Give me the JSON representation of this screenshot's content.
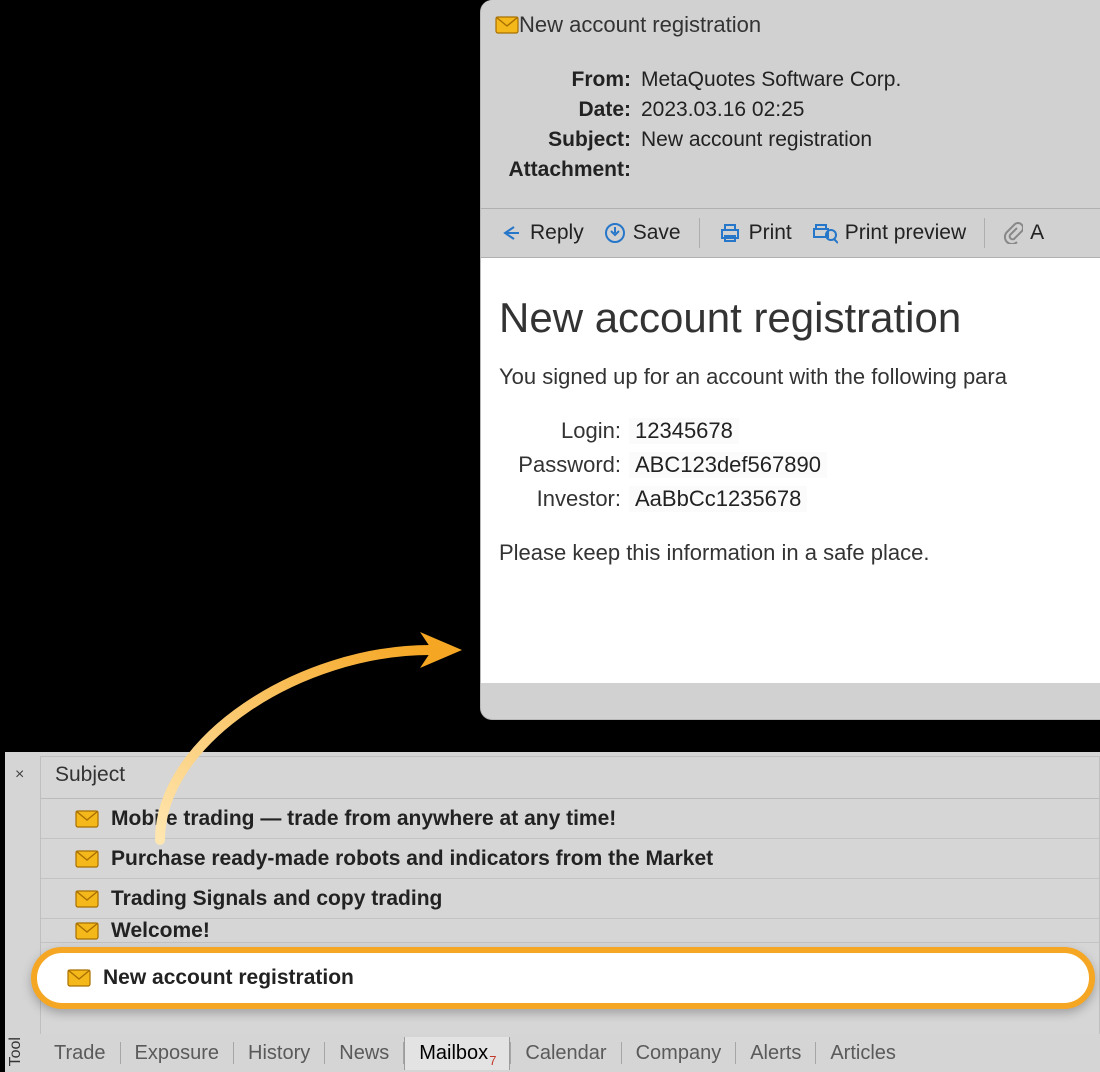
{
  "message": {
    "title": "New account registration",
    "headers": {
      "from_label": "From:",
      "from_value": "MetaQuotes Software Corp.",
      "date_label": "Date:",
      "date_value": "2023.03.16 02:25",
      "subject_label": "Subject:",
      "subject_value": "New account registration",
      "attachment_label": "Attachment:"
    },
    "toolbar": {
      "reply": "Reply",
      "save": "Save",
      "print": "Print",
      "print_preview": "Print preview",
      "attach_fragment": "A"
    },
    "body": {
      "heading": "New account registration",
      "intro": "You signed up for an account with the following para",
      "credentials": {
        "login_label": "Login:",
        "login_value": "12345678",
        "password_label": "Password:",
        "password_value": "ABC123def567890",
        "investor_label": "Investor:",
        "investor_value": "AaBbCc1235678"
      },
      "safe_note": "Please keep this information in a safe place."
    }
  },
  "toolbox": {
    "close_glyph": "×",
    "vertical_label": "Tool",
    "list_header": "Subject",
    "items": [
      "Mobile trading — trade from anywhere at any time!",
      "Purchase ready-made robots and indicators from the Market",
      "Trading Signals and copy trading",
      "Welcome!"
    ],
    "highlighted_item": "New account registration",
    "tabs": [
      "Trade",
      "Exposure",
      "History",
      "News",
      "Mailbox",
      "Calendar",
      "Company",
      "Alerts",
      "Articles"
    ],
    "active_tab_index": 4,
    "mailbox_badge": "7"
  }
}
